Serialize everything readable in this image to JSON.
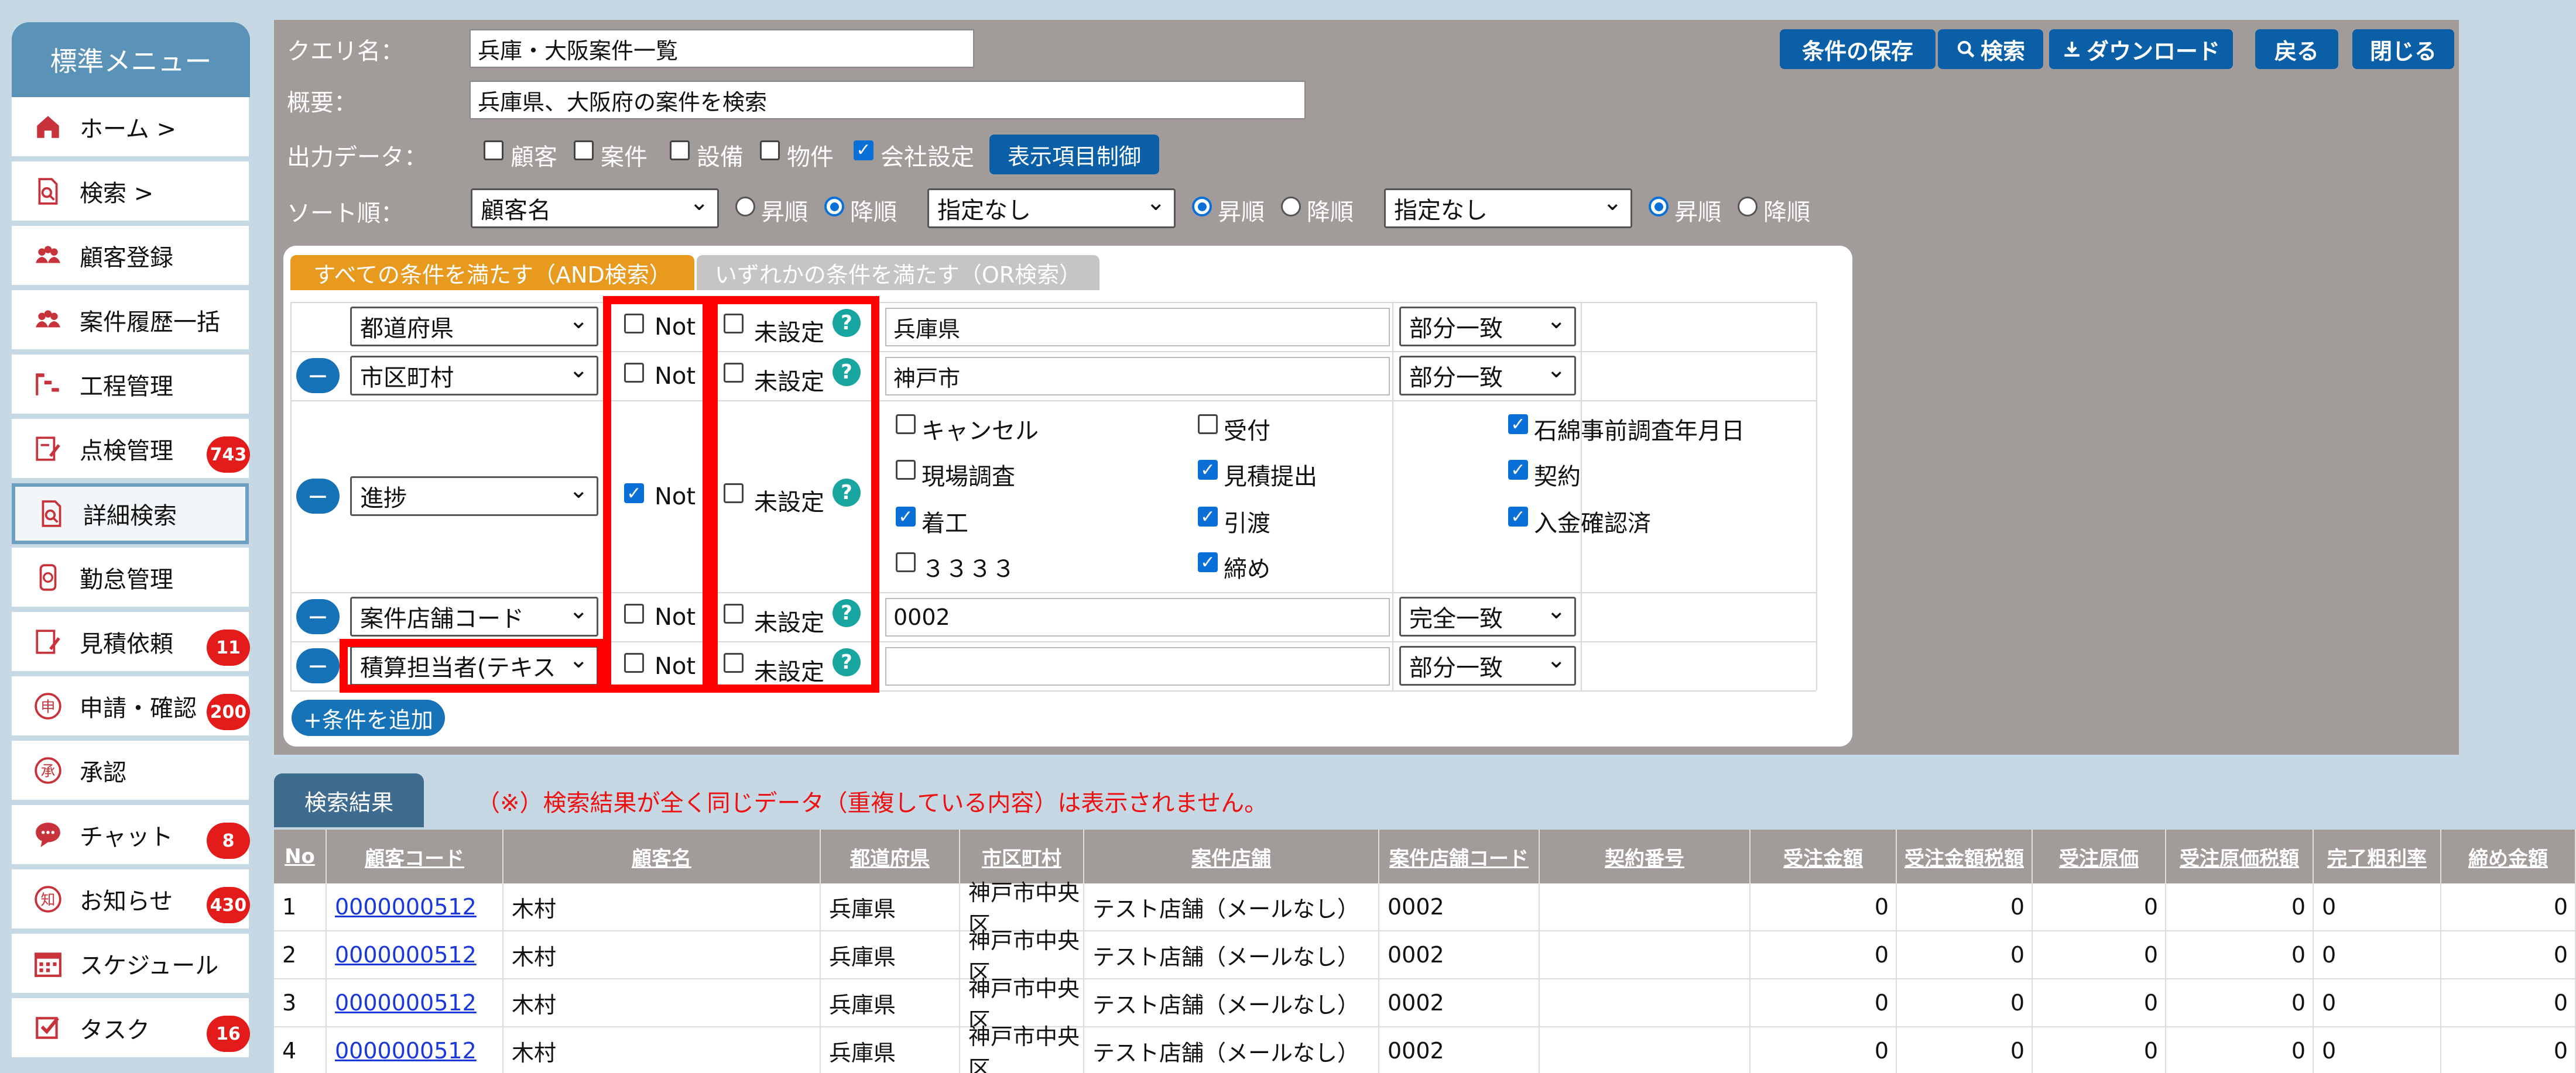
{
  "sidebar": {
    "header": "標準メニュー",
    "items": [
      {
        "label": "ホーム >",
        "icon": "home-icon",
        "badge": ""
      },
      {
        "label": "検索 >",
        "icon": "search-doc-icon",
        "badge": ""
      },
      {
        "label": "顧客登録",
        "icon": "users-icon",
        "badge": ""
      },
      {
        "label": "案件履歴一括",
        "icon": "users-icon",
        "badge": ""
      },
      {
        "label": "工程管理",
        "icon": "process-icon",
        "badge": ""
      },
      {
        "label": "点検管理",
        "icon": "check-edit-icon",
        "badge": "743"
      },
      {
        "label": "詳細検索",
        "icon": "search-doc-icon",
        "badge": ""
      },
      {
        "label": "勤怠管理",
        "icon": "clock-icon",
        "badge": ""
      },
      {
        "label": "見積依頼",
        "icon": "estimate-icon",
        "badge": "11"
      },
      {
        "label": "申請・確認",
        "icon": "apply-icon",
        "badge": "200"
      },
      {
        "label": "承認",
        "icon": "approve-icon",
        "badge": ""
      },
      {
        "label": "チャット",
        "icon": "chat-icon",
        "badge": "8"
      },
      {
        "label": "お知らせ",
        "icon": "notice-icon",
        "badge": "430"
      },
      {
        "label": "スケジュール",
        "icon": "calendar-icon",
        "badge": ""
      },
      {
        "label": "タスク",
        "icon": "task-icon",
        "badge": "16"
      }
    ]
  },
  "query": {
    "name_label": "クエリ名：",
    "name_value": "兵庫・大阪案件一覧",
    "summary_label": "概要：",
    "summary_value": "兵庫県、大阪府の案件を検索",
    "output_label": "出力データ：",
    "output_options": [
      {
        "label": "顧客",
        "checked": false
      },
      {
        "label": "案件",
        "checked": false
      },
      {
        "label": "設備",
        "checked": false
      },
      {
        "label": "物件",
        "checked": false
      },
      {
        "label": "会社設定",
        "checked": true
      }
    ],
    "display_control_btn": "表示項目制御",
    "sort_label": "ソート順：",
    "sort": [
      {
        "field": "顧客名",
        "asc": "昇順",
        "desc": "降順",
        "order": "desc"
      },
      {
        "field": "指定なし",
        "asc": "昇順",
        "desc": "降順",
        "order": "asc"
      },
      {
        "field": "指定なし",
        "asc": "昇順",
        "desc": "降順",
        "order": "asc"
      }
    ]
  },
  "toolbar": {
    "save": "条件の保存",
    "search": "検索",
    "download": "ダウンロード",
    "back": "戻る",
    "close": "閉じる"
  },
  "conditions": {
    "tab_and": "すべての条件を満たす（AND検索）",
    "tab_or": "いずれかの条件を満たす（OR検索）",
    "not_label": "Not",
    "unset_label": "未設定",
    "rows": [
      {
        "field": "都道府県",
        "not": false,
        "unset": false,
        "value": "兵庫県",
        "match": "部分一致"
      },
      {
        "field": "市区町村",
        "not": false,
        "unset": false,
        "value": "神戸市",
        "match": "部分一致"
      },
      {
        "field": "進捗",
        "not": true,
        "unset": false
      },
      {
        "field": "案件店舗コード",
        "not": false,
        "unset": false,
        "value": "0002",
        "match": "完全一致"
      },
      {
        "field": "積算担当者(テキス",
        "not": false,
        "unset": false,
        "value": "",
        "match": "部分一致"
      }
    ],
    "progress_options": [
      {
        "label": "キャンセル",
        "checked": false
      },
      {
        "label": "受付",
        "checked": false
      },
      {
        "label": "石綿事前調査年月日",
        "checked": true
      },
      {
        "label": "現場調査",
        "checked": false
      },
      {
        "label": "見積提出",
        "checked": true
      },
      {
        "label": "契約",
        "checked": true
      },
      {
        "label": "着工",
        "checked": true
      },
      {
        "label": "引渡",
        "checked": true
      },
      {
        "label": "入金確認済",
        "checked": true
      },
      {
        "label": "３３３３",
        "checked": false
      },
      {
        "label": "締め",
        "checked": true
      }
    ],
    "add_button": "+条件を追加"
  },
  "results": {
    "tab": "検索結果",
    "note": "（※）検索結果が全く同じデータ（重複している内容）は表示されません。",
    "columns": [
      "No",
      "顧客コード",
      "顧客名",
      "都道府県",
      "市区町村",
      "案件店舗",
      "案件店舗コード",
      "契約番号",
      "受注金額",
      "受注金額税額",
      "受注原価",
      "受注原価税額",
      "完了粗利率",
      "締め金額"
    ],
    "rows": [
      [
        "1",
        "0000000512",
        "木村",
        "兵庫県",
        "神戸市中央区",
        "テスト店舗（メールなし）",
        "0002",
        "",
        "0",
        "0",
        "0",
        "0",
        "0",
        "0"
      ],
      [
        "2",
        "0000000512",
        "木村",
        "兵庫県",
        "神戸市中央区",
        "テスト店舗（メールなし）",
        "0002",
        "",
        "0",
        "0",
        "0",
        "0",
        "0",
        "0"
      ],
      [
        "3",
        "0000000512",
        "木村",
        "兵庫県",
        "神戸市中央区",
        "テスト店舗（メールなし）",
        "0002",
        "",
        "0",
        "0",
        "0",
        "0",
        "0",
        "0"
      ],
      [
        "4",
        "0000000512",
        "木村",
        "兵庫県",
        "神戸市中央区",
        "テスト店舗（メールなし）",
        "0002",
        "",
        "0",
        "0",
        "0",
        "0",
        "0",
        "0"
      ]
    ]
  },
  "colors": {
    "accent": "#0b5fa6",
    "panel": "#a19c9a",
    "and_tab": "#e79a1e",
    "badge": "#e41b1b",
    "highlight": "#ff0000"
  }
}
